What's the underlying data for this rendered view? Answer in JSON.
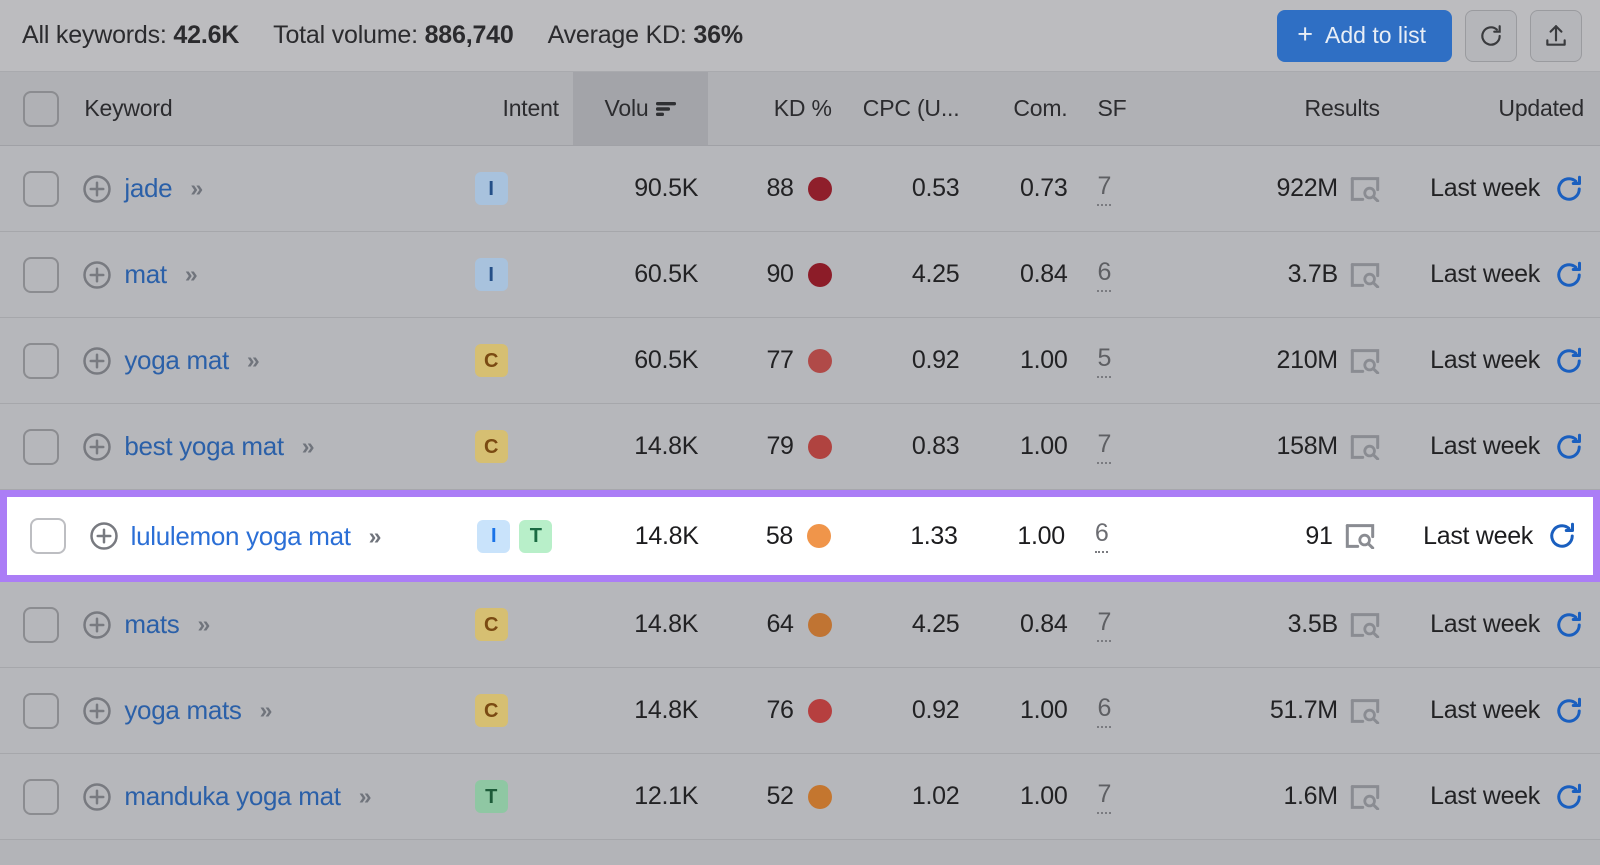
{
  "topbar": {
    "stats": [
      {
        "label": "All keywords:",
        "value": "42.6K"
      },
      {
        "label": "Total volume:",
        "value": "886,740"
      },
      {
        "label": "Average KD:",
        "value": "36%"
      }
    ],
    "add_to_list_label": "Add to list",
    "add_plus": "+",
    "refresh_icon": "refresh-icon",
    "export_icon": "export-icon",
    "accent_blue": "#2f6fc4"
  },
  "table": {
    "columns": [
      {
        "key": "check",
        "label": ""
      },
      {
        "key": "keyword",
        "label": "Keyword"
      },
      {
        "key": "intent",
        "label": "Intent"
      },
      {
        "key": "volume",
        "label": "Volu",
        "sorted": true,
        "sort_icon": "sort-descending-icon"
      },
      {
        "key": "kd",
        "label": "KD %"
      },
      {
        "key": "cpc",
        "label": "CPC (U..."
      },
      {
        "key": "com",
        "label": "Com."
      },
      {
        "key": "sf",
        "label": "SF"
      },
      {
        "key": "results",
        "label": "Results"
      },
      {
        "key": "updated",
        "label": "Updated"
      }
    ],
    "rows": [
      {
        "keyword": "jade",
        "intent": [
          "I"
        ],
        "volume": "90.5K",
        "kd": "88",
        "kd_color": "#8f1f2b",
        "cpc": "0.53",
        "com": "0.73",
        "sf": "7",
        "results": "922M",
        "updated": "Last week",
        "highlight": false
      },
      {
        "keyword": "mat",
        "intent": [
          "I"
        ],
        "volume": "60.5K",
        "kd": "90",
        "kd_color": "#8c1c28",
        "cpc": "4.25",
        "com": "0.84",
        "sf": "6",
        "results": "3.7B",
        "updated": "Last week",
        "highlight": false
      },
      {
        "keyword": "yoga mat",
        "intent": [
          "C"
        ],
        "volume": "60.5K",
        "kd": "77",
        "kd_color": "#b04a48",
        "cpc": "0.92",
        "com": "1.00",
        "sf": "5",
        "results": "210M",
        "updated": "Last week",
        "highlight": false
      },
      {
        "keyword": "best yoga mat",
        "intent": [
          "C"
        ],
        "volume": "14.8K",
        "kd": "79",
        "kd_color": "#b04340",
        "cpc": "0.83",
        "com": "1.00",
        "sf": "7",
        "results": "158M",
        "updated": "Last week",
        "highlight": false
      },
      {
        "keyword": "lululemon yoga mat",
        "intent": [
          "I",
          "T"
        ],
        "volume": "14.8K",
        "kd": "58",
        "kd_color": "#f0954a",
        "cpc": "1.33",
        "com": "1.00",
        "sf": "6",
        "results": "91",
        "updated": "Last week",
        "highlight": true
      },
      {
        "keyword": "mats",
        "intent": [
          "C"
        ],
        "volume": "14.8K",
        "kd": "64",
        "kd_color": "#c07433",
        "cpc": "4.25",
        "com": "0.84",
        "sf": "7",
        "results": "3.5B",
        "updated": "Last week",
        "highlight": false
      },
      {
        "keyword": "yoga mats",
        "intent": [
          "C"
        ],
        "volume": "14.8K",
        "kd": "76",
        "kd_color": "#b63f3f",
        "cpc": "0.92",
        "com": "1.00",
        "sf": "6",
        "results": "51.7M",
        "updated": "Last week",
        "highlight": false
      },
      {
        "keyword": "manduka yoga mat",
        "intent": [
          "T"
        ],
        "volume": "12.1K",
        "kd": "52",
        "kd_color": "#c4762f",
        "cpc": "1.02",
        "com": "1.00",
        "sf": "7",
        "results": "1.6M",
        "updated": "Last week",
        "highlight": false
      }
    ],
    "row_icons": {
      "add_keyword": "plus-circle-icon",
      "expand": "»",
      "serp": "serp-preview-icon",
      "update": "refresh-icon"
    },
    "highlight_color": "#ab7df6"
  }
}
